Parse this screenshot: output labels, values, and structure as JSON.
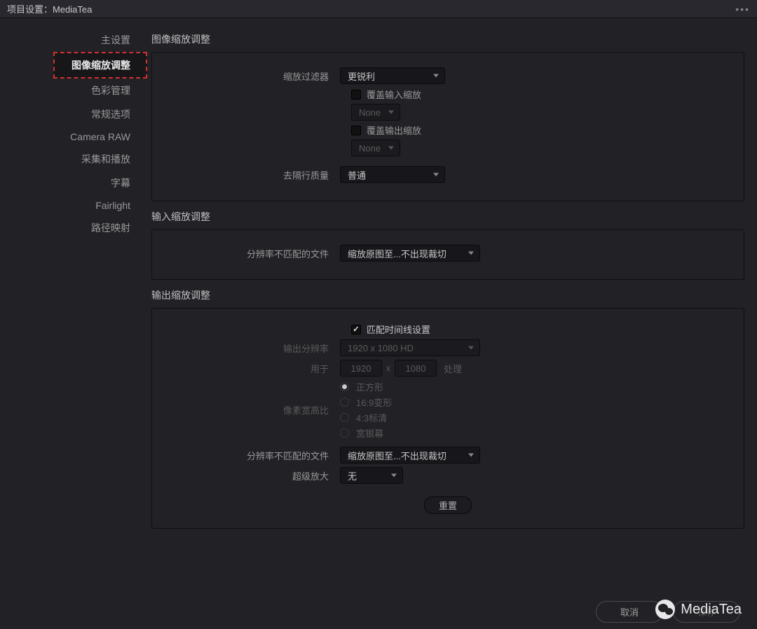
{
  "titlebar": {
    "title": "项目设置：MediaTea"
  },
  "sidebar": {
    "items": [
      {
        "label": "主设置"
      },
      {
        "label": "图像缩放调整"
      },
      {
        "label": "色彩管理"
      },
      {
        "label": "常规选项"
      },
      {
        "label": "Camera RAW"
      },
      {
        "label": "采集和播放"
      },
      {
        "label": "字幕"
      },
      {
        "label": "Fairlight"
      },
      {
        "label": "路径映射"
      }
    ]
  },
  "section1": {
    "title": "图像缩放调整",
    "filter_label": "缩放过滤器",
    "filter_value": "更锐利",
    "override_input": "覆盖输入缩放",
    "override_output": "覆盖输出缩放",
    "none1": "None",
    "none2": "None",
    "deinterlace_label": "去隔行质量",
    "deinterlace_value": "普通"
  },
  "section2": {
    "title": "输入缩放调整",
    "mismatch_label": "分辨率不匹配的文件",
    "mismatch_value": "缩放原图至...不出现裁切"
  },
  "section3": {
    "title": "输出缩放调整",
    "match_timeline": "匹配时间线设置",
    "out_res_label": "输出分辨率",
    "out_res_value": "1920 x 1080 HD",
    "for_label": "用于",
    "w": "1920",
    "h": "1080",
    "process": "处理",
    "par_label": "像素宽高比",
    "par_options": [
      "正方形",
      "16:9变形",
      "4:3标清",
      "宽银幕"
    ],
    "mismatch_label": "分辨率不匹配的文件",
    "mismatch_value": "缩放原图至...不出现裁切",
    "super_label": "超级放大",
    "super_value": "无",
    "reset": "重置"
  },
  "footer": {
    "cancel": "取消",
    "save": "保存"
  },
  "watermark": "MediaTea"
}
